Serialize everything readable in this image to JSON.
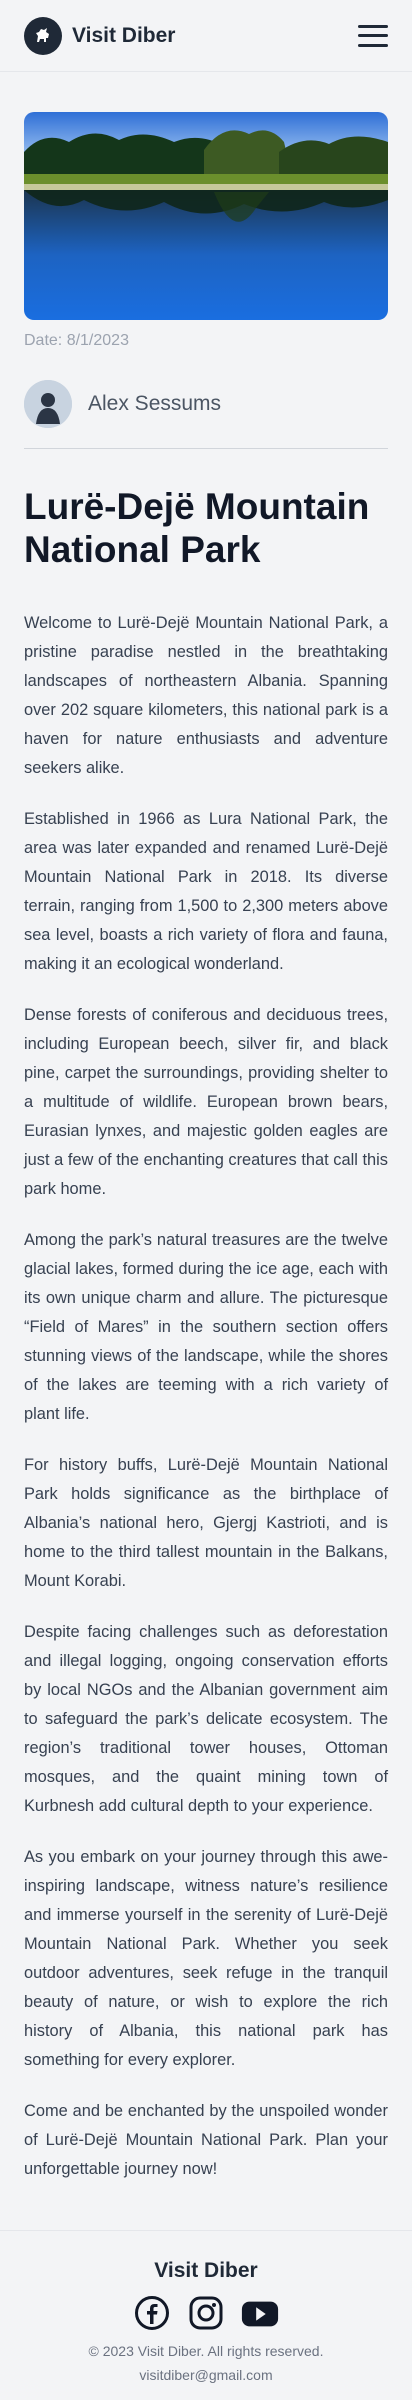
{
  "header": {
    "brand": "Visit Diber",
    "logo_icon": "goat-icon",
    "menu_icon": "hamburger-menu-icon"
  },
  "article": {
    "date": "Date: 8/1/2023",
    "author": "Alex Sessums",
    "title": "Lurë-Dejë Mountain National Park",
    "paragraphs": [
      "Welcome to Lurë-Dejë Mountain National Park, a pristine paradise nestled in the breathtaking landscapes of northeastern Albania. Spanning over 202 square kilometers, this national park is a haven for nature enthusiasts and adventure seekers alike.",
      "Established in 1966 as Lura National Park, the area was later expanded and renamed Lurë-Dejë Mountain National Park in 2018. Its diverse terrain, ranging from 1,500 to 2,300 meters above sea level, boasts a rich variety of flora and fauna, making it an ecological wonderland.",
      "Dense forests of coniferous and deciduous trees, including European beech, silver fir, and black pine, carpet the surroundings, providing shelter to a multitude of wildlife. European brown bears, Eurasian lynxes, and majestic golden eagles are just a few of the enchanting creatures that call this park home.",
      "Among the park’s natural treasures are the twelve glacial lakes, formed during the ice age, each with its own unique charm and allure. The picturesque “Field of Mares” in the southern section offers stunning views of the landscape, while the shores of the lakes are teeming with a rich variety of plant life.",
      "For history buffs, Lurë-Dejë Mountain National Park holds significance as the birthplace of Albania’s national hero, Gjergj Kastrioti, and is home to the third tallest mountain in the Balkans, Mount Korabi.",
      "Despite facing challenges such as deforestation and illegal logging, ongoing conservation efforts by local NGOs and the Albanian government aim to safeguard the park’s delicate ecosystem. The region’s traditional tower houses, Ottoman mosques, and the quaint mining town of Kurbnesh add cultural depth to your experience.",
      "As you embark on your journey through this awe-inspiring landscape, witness nature’s resilience and immerse yourself in the serenity of Lurë-Dejë Mountain National Park. Whether you seek outdoor adventures, seek refuge in the tranquil beauty of nature, or wish to explore the rich history of Albania, this national park has something for every explorer.",
      "Come and be enchanted by the unspoiled wonder of Lurë-Dejë Mountain National Park. Plan your unforgettable journey now!"
    ]
  },
  "footer": {
    "brand": "Visit Diber",
    "socials": [
      "facebook-icon",
      "instagram-icon",
      "youtube-icon"
    ],
    "copyright": "© 2023 Visit Diber. All rights reserved.",
    "email": "visitdiber@gmail.com"
  },
  "colors": {
    "background": "#f3f4f6",
    "text_dark": "#111827",
    "text_body": "#374151",
    "muted": "#9ca3af"
  }
}
